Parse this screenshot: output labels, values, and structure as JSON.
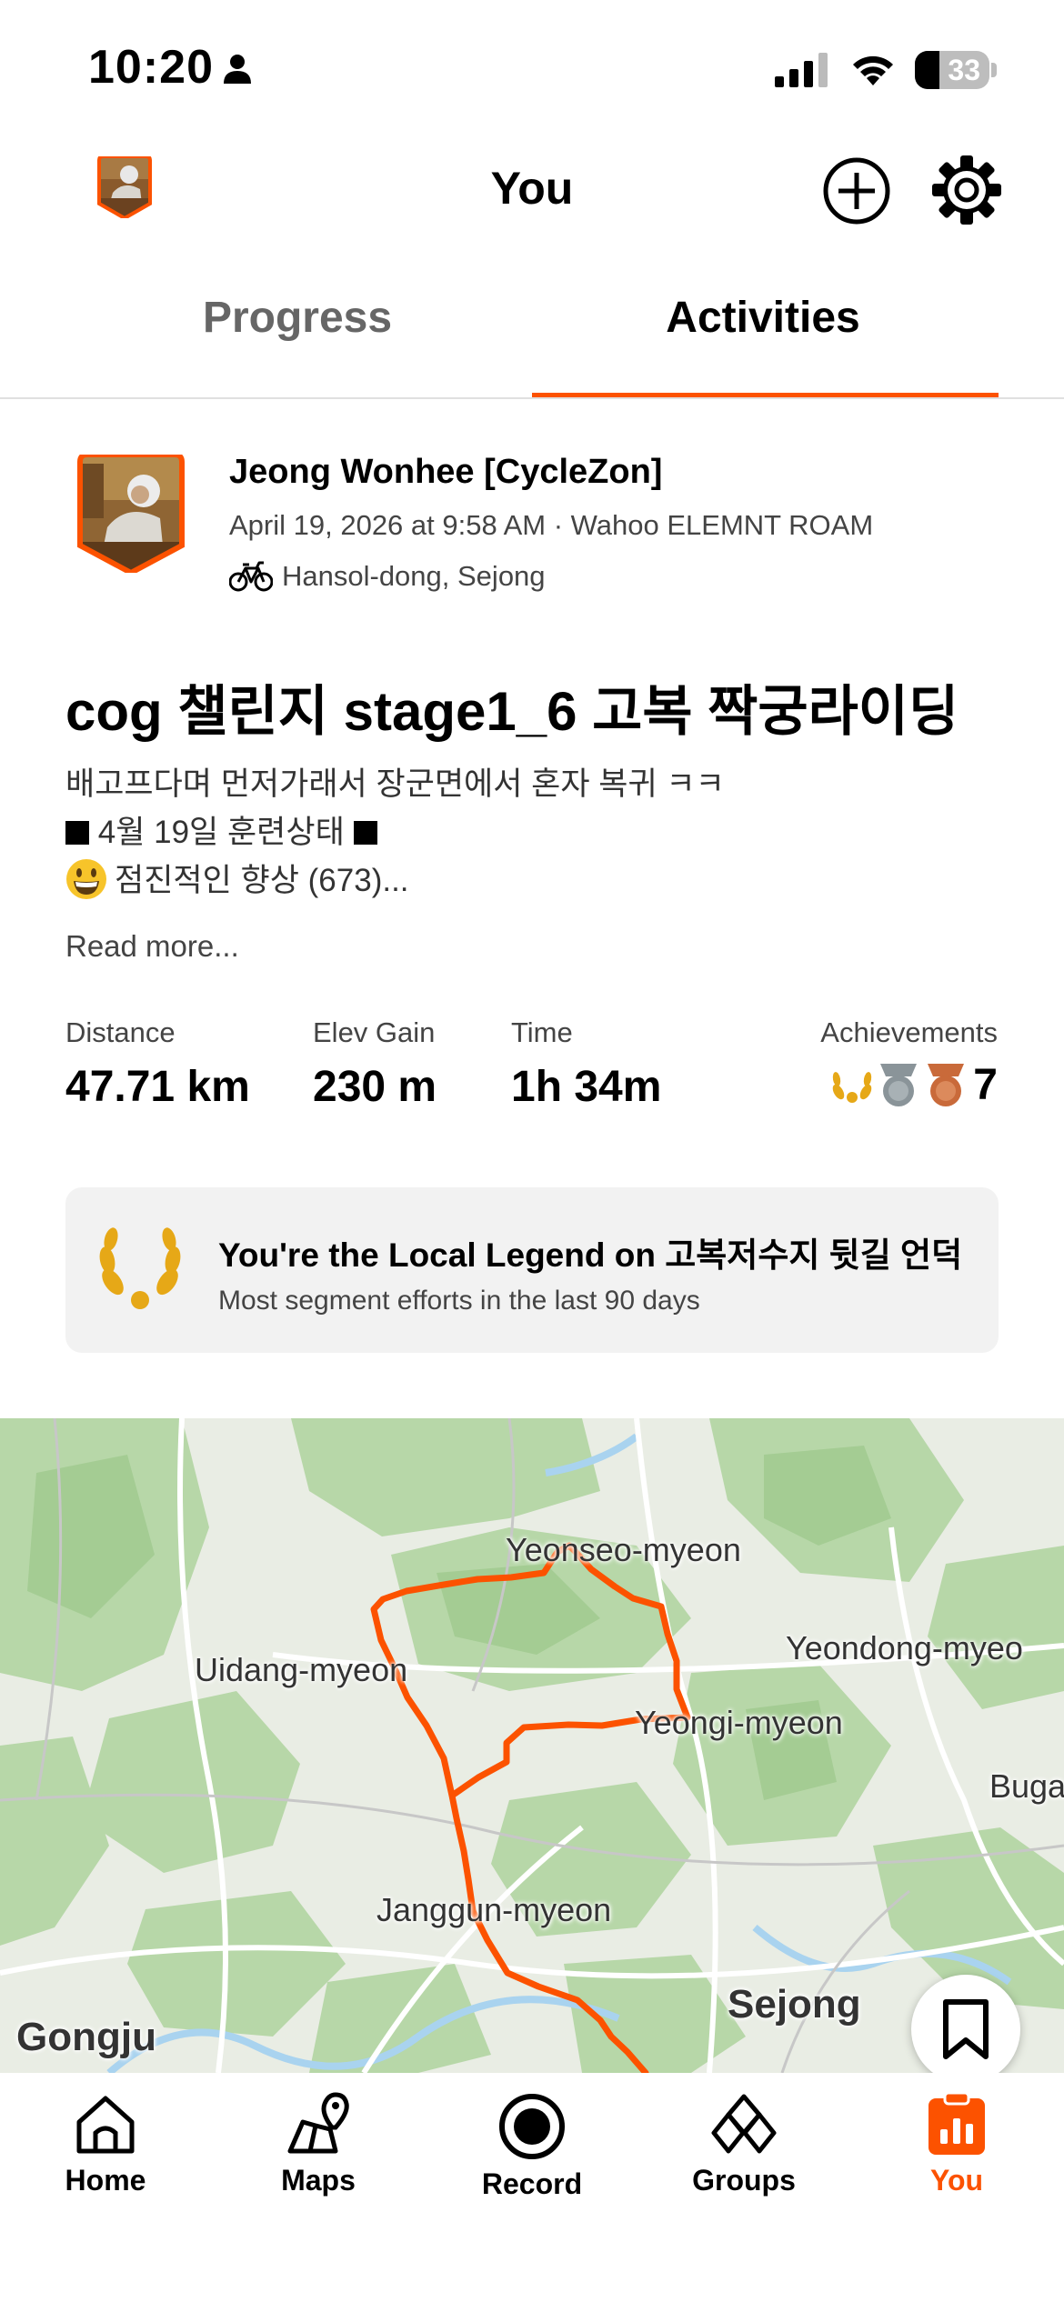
{
  "status_bar": {
    "time": "10:20",
    "battery": "33",
    "battery_level": 0.33
  },
  "header": {
    "title": "You"
  },
  "tabs": [
    {
      "label": "Progress"
    },
    {
      "label": "Activities"
    }
  ],
  "activity": {
    "athlete_name": "Jeong Wonhee  [CycleZon]",
    "meta": "April 19, 2026 at 9:58 AM · Wahoo ELEMNT ROAM",
    "location": "Hansol-dong, Sejong",
    "title": "cog 챌린지 stage1_6 고복 짝궁라이딩",
    "description": {
      "line1": "배고프다며 먼저가래서 장군면에서 혼자 복귀 ㅋㅋ",
      "line2": " 4월 19일 훈련상태 ",
      "line3": "점진적인 향상 (673)..."
    },
    "read_more": "Read more...",
    "stats": {
      "distance_label": "Distance",
      "distance_value": "47.71 km",
      "elev_label": "Elev Gain",
      "elev_value": "230 m",
      "time_label": "Time",
      "time_value": "1h 34m",
      "achievements_label": "Achievements",
      "achievements_count": "7"
    },
    "legend": {
      "title": "You're the Local Legend on 고복저수지 뒷길 언덕",
      "subtitle": "Most segment efforts in the last 90 days"
    }
  },
  "map": {
    "labels": {
      "yeonseo": "Yeonseo-myeon",
      "uidang": "Uidang-myeon",
      "yeondong": "Yeondong-myeo",
      "yeongi": "Yeongi-myeon",
      "buga": "Buga",
      "janggun": "Janggun-myeon",
      "sejong": "Sejong",
      "gongju": "Gongju"
    }
  },
  "nav": [
    {
      "label": "Home"
    },
    {
      "label": "Maps"
    },
    {
      "label": "Record"
    },
    {
      "label": "Groups"
    },
    {
      "label": "You"
    }
  ],
  "colors": {
    "accent": "#fc5200",
    "gold": "#e6a817",
    "silver": "#8a9499",
    "bronze": "#c96a3a"
  }
}
